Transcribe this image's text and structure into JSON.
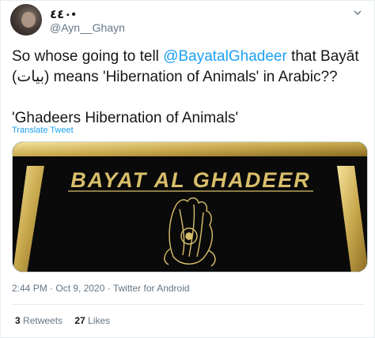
{
  "author": {
    "display_name": "٤٤٠•",
    "handle": "@Ayn__Ghayn"
  },
  "tweet": {
    "text_line1_before": "So whose going to tell ",
    "mention": "@BayatalGhadeer",
    "text_line1_after": " that Bayāt",
    "text_line2": "(بيات) means 'Hibernation of Animals' in Arabic??",
    "text_line3": "'Ghadeers Hibernation of Animals'",
    "translate_label": "Translate Tweet"
  },
  "media": {
    "logo_text": "BAYAT AL GHADEER",
    "accent_color": "#d9bf6b",
    "background_color": "#0a0a0a"
  },
  "meta": {
    "timestamp": "2:44 PM · Oct 9, 2020 · Twitter for Android"
  },
  "stats": {
    "retweets_count": "3",
    "retweets_label": "Retweets",
    "likes_count": "27",
    "likes_label": "Likes"
  },
  "icons": {
    "menu": "chevron-down-icon"
  }
}
